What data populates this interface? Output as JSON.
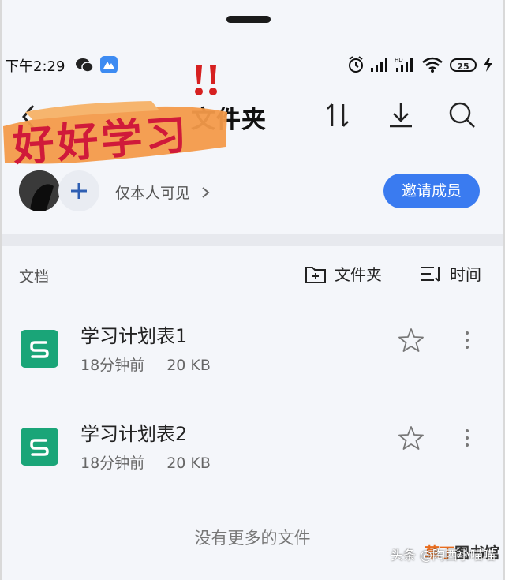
{
  "status_bar": {
    "time": "下午2:29",
    "battery": "25",
    "icons": [
      "wechat-icon",
      "app-icon",
      "alarm-icon",
      "signal-icon",
      "signal-hd-icon",
      "wifi-icon",
      "battery-icon",
      "charging-icon"
    ]
  },
  "header": {
    "title": "文件夹",
    "actions": [
      "sort-icon",
      "download-icon",
      "search-icon"
    ],
    "sticker_text": "好好学习"
  },
  "members": {
    "visibility": "仅本人可见",
    "invite_label": "邀请成员"
  },
  "list": {
    "section_label": "文档",
    "new_folder_label": "文件夹",
    "sort_label": "时间",
    "files": [
      {
        "name": "学习计划表1",
        "time": "18分钟前",
        "size": "20 KB"
      },
      {
        "name": "学习计划表2",
        "time": "18分钟前",
        "size": "20 KB"
      }
    ],
    "footer": "没有更多的文件"
  },
  "watermark": {
    "logo_orange": "草丁",
    "logo_dark": "图书馆",
    "text": "头条 @陶西小喵喵"
  },
  "colors": {
    "accent": "#3a7bf0",
    "sheet_icon": "#1aa578",
    "sticker": "#f39a4a"
  }
}
